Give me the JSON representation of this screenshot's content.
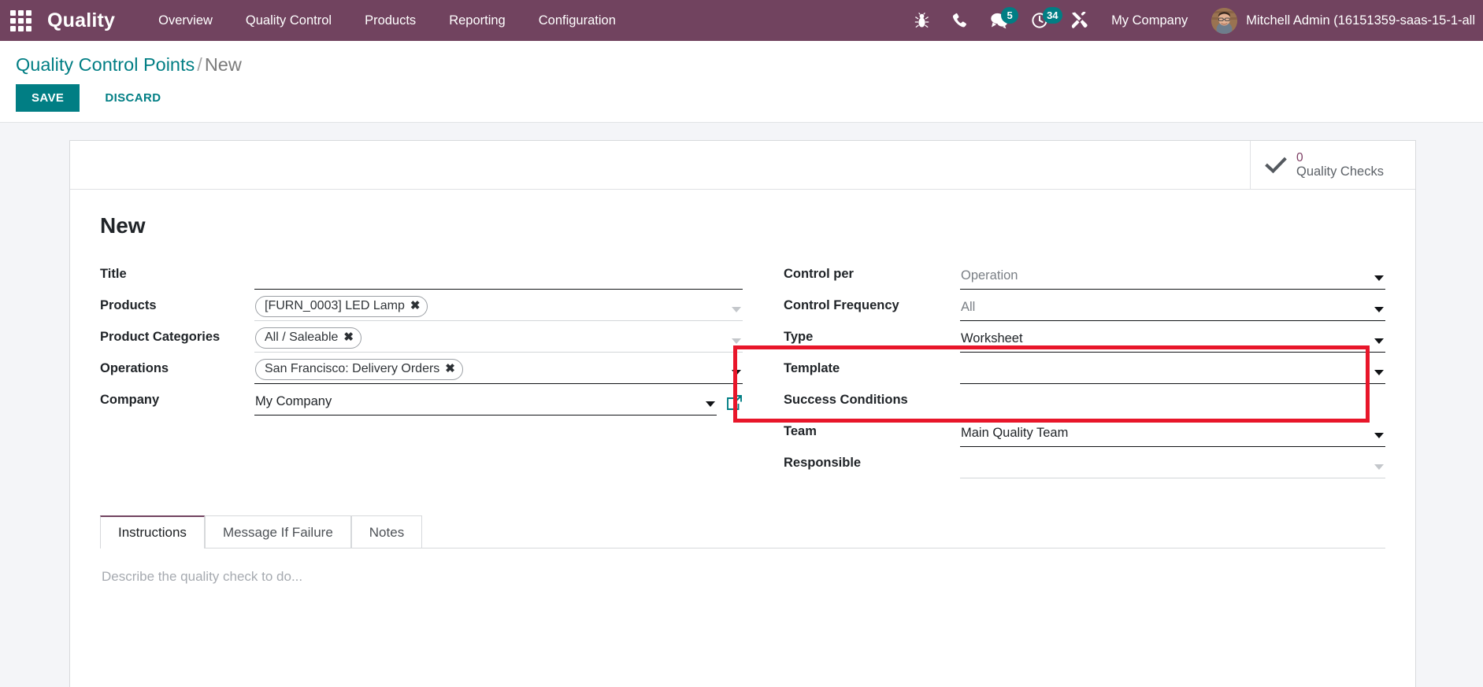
{
  "navbar": {
    "apps_icon": "apps-grid-icon",
    "brand": "Quality",
    "menu": [
      {
        "label": "Overview"
      },
      {
        "label": "Quality Control"
      },
      {
        "label": "Products"
      },
      {
        "label": "Reporting"
      },
      {
        "label": "Configuration"
      }
    ],
    "tray": [
      {
        "name": "debug-bug-icon",
        "icon": "bug",
        "badge": null
      },
      {
        "name": "voip-phone-icon",
        "icon": "phone",
        "badge": null
      },
      {
        "name": "messages-icon",
        "icon": "chat",
        "badge": "5"
      },
      {
        "name": "activities-icon",
        "icon": "clock",
        "badge": "34"
      },
      {
        "name": "settings-tools-icon",
        "icon": "tools",
        "badge": null
      }
    ],
    "company": "My Company",
    "user": "Mitchell Admin (16151359-saas-15-1-all",
    "colors": {
      "background": "#71435F",
      "badge": "#017E84"
    }
  },
  "control_panel": {
    "breadcrumb_root": "Quality Control Points",
    "breadcrumb_separator": "/",
    "breadcrumb_current": "New",
    "save_label": "SAVE",
    "discard_label": "DISCARD",
    "accent": "#017E84"
  },
  "stat_buttons": [
    {
      "icon": "check-icon",
      "value": "0",
      "label": "Quality Checks"
    }
  ],
  "form": {
    "record_title": "New",
    "left_fields": [
      {
        "label": "Title",
        "type": "text",
        "value": "",
        "tags": [],
        "caret": "none",
        "line": "solid"
      },
      {
        "label": "Products",
        "type": "tags",
        "value": "",
        "tags": [
          "[FURN_0003] LED Lamp"
        ],
        "caret": "dim",
        "line": "light"
      },
      {
        "label": "Product Categories",
        "type": "tags",
        "value": "",
        "tags": [
          "All / Saleable"
        ],
        "caret": "dim",
        "line": "light"
      },
      {
        "label": "Operations",
        "type": "tags",
        "value": "",
        "tags": [
          "San Francisco: Delivery Orders"
        ],
        "caret": "solid",
        "line": "solid"
      },
      {
        "label": "Company",
        "type": "many2one",
        "value": "My Company",
        "tags": [],
        "caret": "solid",
        "line": "solid",
        "external_link": true
      }
    ],
    "right_fields": [
      {
        "label": "Control per",
        "type": "select",
        "value": "Operation",
        "muted": true,
        "caret": "solid",
        "line": "solid"
      },
      {
        "label": "Control Frequency",
        "type": "select",
        "value": "All",
        "muted": true,
        "caret": "solid",
        "line": "solid"
      },
      {
        "label": "Type",
        "type": "select",
        "value": "Worksheet",
        "muted": false,
        "caret": "solid",
        "line": "solid",
        "highlighted": true
      },
      {
        "label": "Template",
        "type": "many2one",
        "value": "",
        "muted": false,
        "caret": "solid",
        "line": "solid",
        "highlighted": true
      },
      {
        "label": "Success Conditions",
        "type": "heading",
        "value": "",
        "muted": false,
        "caret": "none",
        "line": "none"
      },
      {
        "label": "Team",
        "type": "many2one",
        "value": "Main Quality Team",
        "muted": false,
        "caret": "solid",
        "line": "solid"
      },
      {
        "label": "Responsible",
        "type": "many2one",
        "value": "",
        "muted": false,
        "caret": "dim",
        "line": "light"
      }
    ],
    "annotation": {
      "shape": "rectangle",
      "color": "#E8162A",
      "covers": [
        "Type",
        "Template"
      ]
    }
  },
  "notebook": {
    "tabs": [
      {
        "label": "Instructions",
        "active": true
      },
      {
        "label": "Message If Failure",
        "active": false
      },
      {
        "label": "Notes",
        "active": false
      }
    ],
    "active_placeholder": "Describe the quality check to do..."
  }
}
